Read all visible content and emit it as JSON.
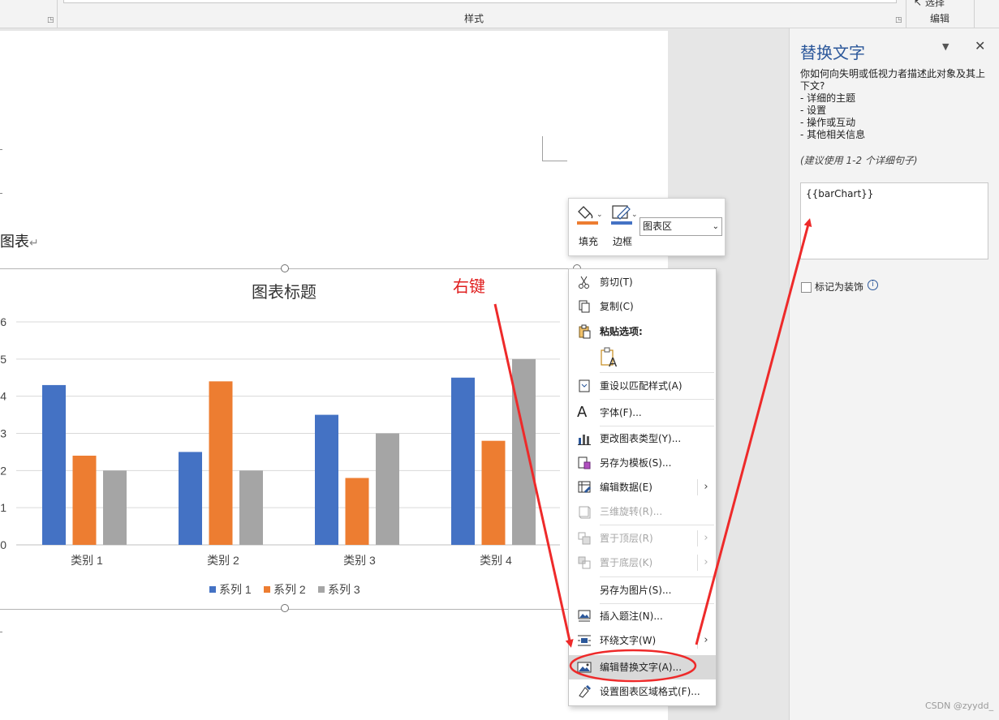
{
  "ribbon": {
    "style_group_label": "样式",
    "edit_group_label": "编辑",
    "edit_top_label": "选择"
  },
  "document": {
    "caption_text": "图表",
    "paragraph_mark": "↵"
  },
  "annotation": {
    "right_click_label": "右键",
    "color": "#e02020"
  },
  "chart_data": {
    "type": "bar",
    "title": "图表标题",
    "categories": [
      "类别 1",
      "类别 2",
      "类别 3",
      "类别 4"
    ],
    "series": [
      {
        "name": "系列 1",
        "color": "#4472c4",
        "values": [
          4.3,
          2.5,
          3.5,
          4.5
        ]
      },
      {
        "name": "系列 2",
        "color": "#ed7d31",
        "values": [
          2.4,
          4.4,
          1.8,
          2.8
        ]
      },
      {
        "name": "系列 3",
        "color": "#a5a5a5",
        "values": [
          2.0,
          2.0,
          3.0,
          5.0
        ]
      }
    ],
    "ylim": [
      0,
      6
    ],
    "yticks": [
      "0",
      "1",
      "2",
      "3",
      "4",
      "5",
      "6"
    ],
    "grid": true,
    "legend": "bottom"
  },
  "mini_toolbar": {
    "fill_label": "填充",
    "border_label": "边框",
    "element_select": "图表区",
    "fill_color": "#ed7d31",
    "border_color": "#4472c4"
  },
  "context_menu": {
    "items": [
      {
        "label": "剪切(T)",
        "icon": "scissors-icon"
      },
      {
        "label": "复制(C)",
        "icon": "copy-icon"
      },
      {
        "label": "粘贴选项:",
        "icon": "paste-icon"
      },
      {
        "label": "重设以匹配样式(A)",
        "icon": "reset-style-icon"
      },
      {
        "label": "字体(F)...",
        "icon": "font-icon"
      },
      {
        "label": "更改图表类型(Y)...",
        "icon": "chart-type-icon"
      },
      {
        "label": "另存为模板(S)...",
        "icon": "template-icon"
      },
      {
        "label": "编辑数据(E)",
        "icon": "edit-data-icon"
      },
      {
        "label": "三维旋转(R)...",
        "icon": "rotate-3d-icon"
      },
      {
        "label": "置于顶层(R)",
        "icon": "bring-front-icon"
      },
      {
        "label": "置于底层(K)",
        "icon": "send-back-icon"
      },
      {
        "label": "另存为图片(S)...",
        "icon": ""
      },
      {
        "label": "插入题注(N)...",
        "icon": "caption-icon"
      },
      {
        "label": "环绕文字(W)",
        "icon": "wrap-text-icon"
      },
      {
        "label": "编辑替换文字(A)...",
        "icon": "alt-text-icon"
      },
      {
        "label": "设置图表区域格式(F)...",
        "icon": "format-chart-icon"
      }
    ]
  },
  "alt_text_pane": {
    "title": "替换文字",
    "description_lines": [
      "你如何向失明或低视力者描述此对象及其上",
      "下文?",
      "- 详细的主题",
      "- 设置",
      "- 操作或互动",
      "- 其他相关信息"
    ],
    "hint": "(建议使用 1-2 个详细句子)",
    "alt_text_value": "{{barChart}}",
    "decorative_label": "标记为装饰"
  },
  "watermark": "CSDN @zyydd_"
}
